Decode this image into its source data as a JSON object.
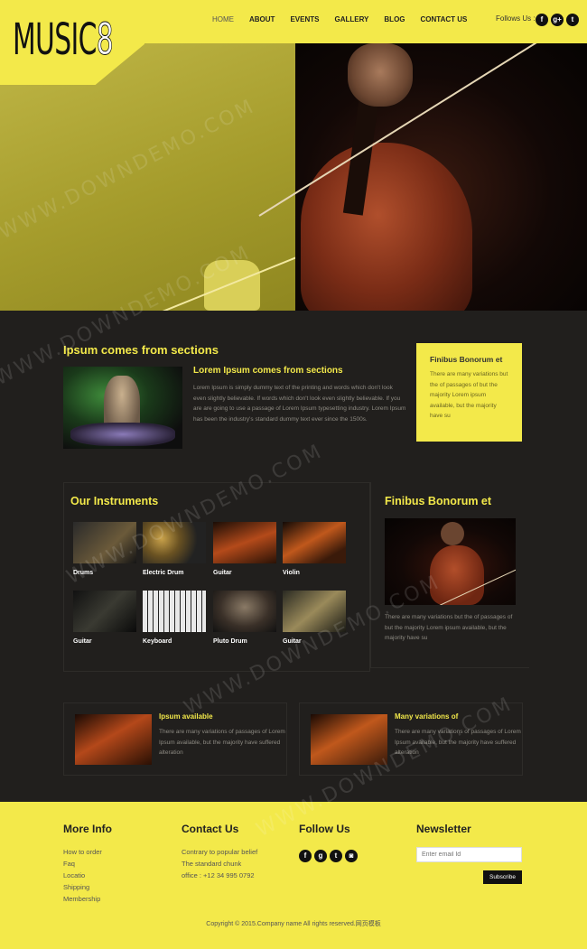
{
  "brand": {
    "logo_main": "MUSIC",
    "logo_accent": "8"
  },
  "nav": {
    "items": [
      "HOME",
      "ABOUT",
      "EVENTS",
      "GALLERY",
      "BLOG",
      "CONTACT US"
    ],
    "active": "HOME"
  },
  "social_header": {
    "label": "Follows Us :",
    "icons": [
      "facebook-icon",
      "google-plus-icon",
      "twitter-icon"
    ]
  },
  "hero": {
    "image": "cellist-photo"
  },
  "section1": {
    "title": "Ipsum comes from sections",
    "subtitle": "Lorem Ipsum comes from sections",
    "text": "Lorem Ipsum is simply dummy text of the printing and words which don't look even slightly believable. If words which don't look even slightly believable. If you are are going to use a passage of Lorem Ipsum typesetting industry. Lorem Ipsum has been the industry's standard dummy text ever since the 1500s."
  },
  "yellow_box": {
    "title": "Finibus Bonorum et",
    "text": "There are many variations but the of passages of but the majority Lorem ipsum available, but the majority have su"
  },
  "instruments": {
    "title": "Our Instruments",
    "items": [
      {
        "label": "Drums"
      },
      {
        "label": "Electric Drum"
      },
      {
        "label": "Guitar"
      },
      {
        "label": "Violin"
      },
      {
        "label": "Guitar"
      },
      {
        "label": "Keyboard"
      },
      {
        "label": "Pluto Drum"
      },
      {
        "label": "Guitar"
      }
    ]
  },
  "finibus": {
    "title": "Finibus Bonorum et",
    "text": "There are many variations but the of passages of but the majority Lorem ipsum available, but the majority have su"
  },
  "cards": [
    {
      "title": "Ipsum available",
      "text": "There are many variations of passages of Lorem Ipsum available, but the majority have suffered alteration"
    },
    {
      "title": "Many variations of",
      "text": "There are many variations of passages of Lorem Ipsum available, but the majority have suffered alteration"
    }
  ],
  "footer": {
    "more_info": {
      "title": "More Info",
      "links": [
        "How to order",
        "Faq",
        "Locatio",
        "Shipping",
        "Membership"
      ]
    },
    "contact": {
      "title": "Contact Us",
      "lines": [
        "Contrary to popular belief",
        "The standard chunk",
        "office : +12 34 995 0792"
      ]
    },
    "follow": {
      "title": "Follow Us",
      "icons": [
        "facebook-icon",
        "google-plus-icon",
        "twitter-icon",
        "instagram-icon"
      ]
    },
    "newsletter": {
      "title": "Newsletter",
      "placeholder": "Enter email Id",
      "button": "Subscribe"
    },
    "copyright": "Copyright © 2015.Company name All rights reserved.网页模板"
  },
  "watermark": "WWW.DOWNDEMO.COM",
  "colors": {
    "accent": "#f3e94a",
    "background": "#211f1d",
    "text_muted": "#8d8a82"
  }
}
